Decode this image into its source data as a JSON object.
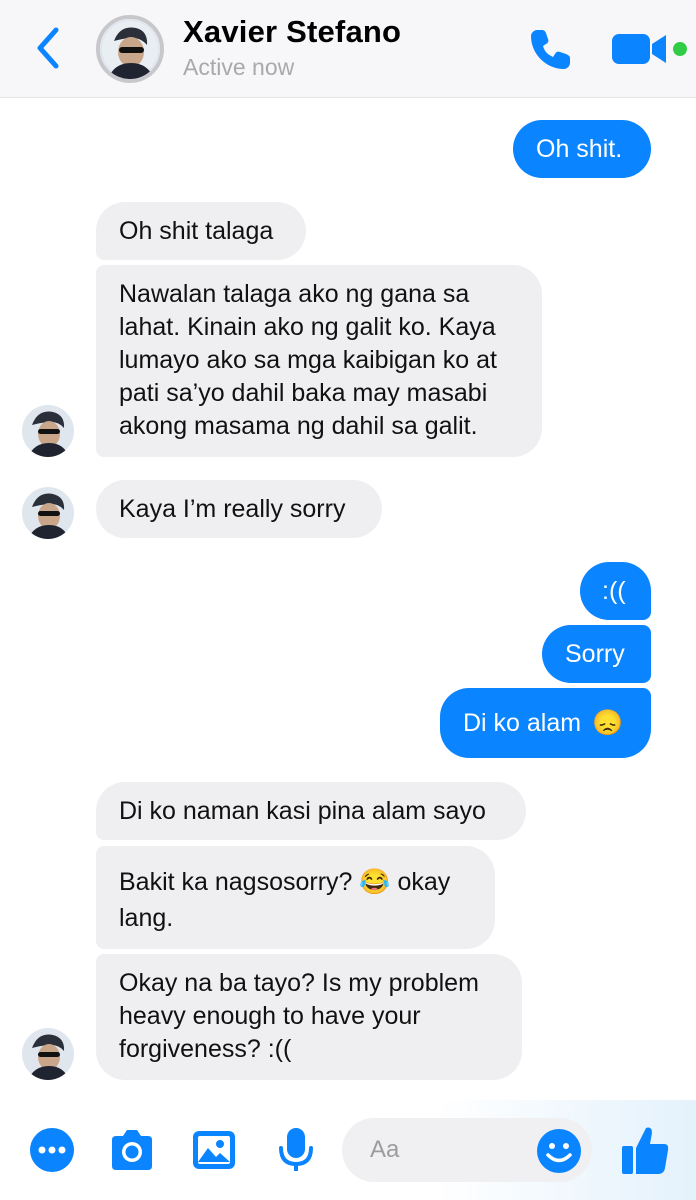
{
  "header": {
    "contact_name": "Xavier Stefano",
    "status": "Active now",
    "back_icon": "chevron-left-icon",
    "call_icon": "phone-icon",
    "video_icon": "video-camera-icon",
    "accent_color": "#0a84ff",
    "online_color": "#31cc46"
  },
  "messages": [
    {
      "sender": "me",
      "text": "Oh shit."
    },
    {
      "sender": "contact",
      "text": "Oh shit talaga"
    },
    {
      "sender": "contact",
      "lines": [
        "Nawalan talaga ako ng gana sa",
        "lahat. Kinain ako ng galit ko. Kaya",
        "lumayo ako sa mga kaibigan ko at",
        "pati sa’yo dahil baka may masabi",
        "akong masama ng dahil sa galit."
      ]
    },
    {
      "sender": "contact",
      "text": "Kaya I’m really sorry"
    },
    {
      "sender": "me",
      "text": ":(("
    },
    {
      "sender": "me",
      "text": "Sorry"
    },
    {
      "sender": "me",
      "text": "Di ko alam",
      "emoji": "😞"
    },
    {
      "sender": "contact",
      "text": "Di ko naman kasi pina alam sayo"
    },
    {
      "sender": "contact",
      "line1": "Bakit ka nagsosorry?",
      "emoji": "😂",
      "line1_end": "okay",
      "line2": "lang."
    },
    {
      "sender": "contact",
      "lines": [
        "Okay na ba tayo? Is my problem",
        "heavy enough to have your",
        "forgiveness? :(("
      ]
    }
  ],
  "composer": {
    "placeholder": "Aa",
    "more_icon": "more-dots-icon",
    "camera_icon": "camera-icon",
    "gallery_icon": "image-icon",
    "mic_icon": "microphone-icon",
    "emoji_icon": "smiley-icon",
    "like_icon": "thumbs-up-icon"
  },
  "colors": {
    "incoming_bubble": "#efeff1",
    "outgoing_bubble": "#0a84ff",
    "header_bg": "#f7f7f9"
  }
}
